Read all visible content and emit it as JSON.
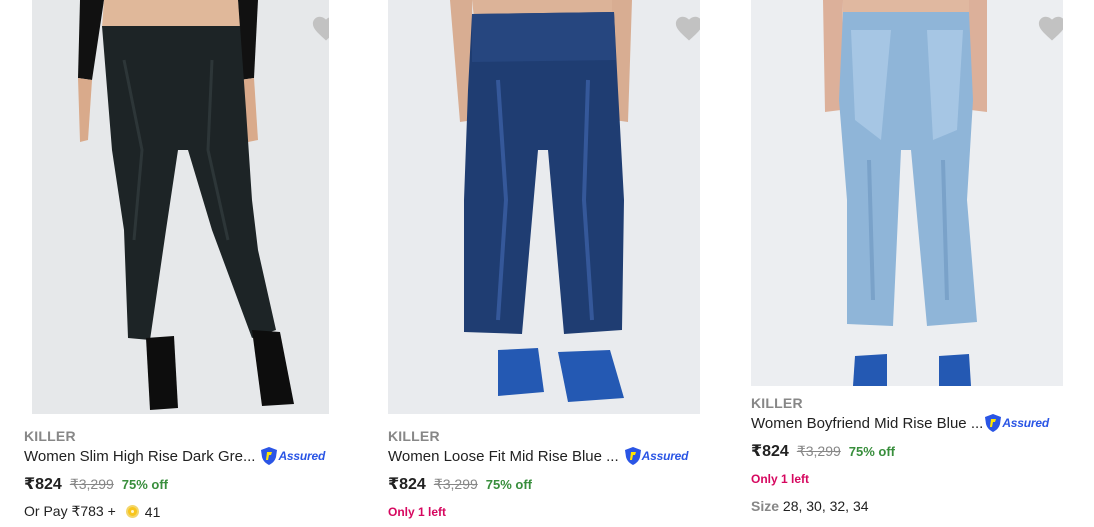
{
  "colors": {
    "heart": "#c2c2c2",
    "discount": "#388e3c",
    "low_stock": "#d6075f",
    "assured": "#2a55e5",
    "brand": "#878787"
  },
  "products": [
    {
      "brand": "KILLER",
      "title": "Women Slim High Rise Dark Gre...",
      "assured": "Assured",
      "price": "₹824",
      "mrp": "₹3,299",
      "discount": "75% off",
      "or_pay": "Or Pay ₹783 +",
      "coins": "41",
      "image": "dark-grey-slim-jeans",
      "wishlist_icon": "heart-icon"
    },
    {
      "brand": "KILLER",
      "title": "Women Loose Fit Mid Rise Blue ...",
      "assured": "Assured",
      "price": "₹824",
      "mrp": "₹3,299",
      "discount": "75% off",
      "stock": "Only 1 left",
      "image": "dark-blue-wide-leg-jeans",
      "wishlist_icon": "heart-icon"
    },
    {
      "brand": "KILLER",
      "title": "Women Boyfriend Mid Rise Blue ...",
      "assured": "Assured",
      "price": "₹824",
      "mrp": "₹3,299",
      "discount": "75% off",
      "stock": "Only 1 left",
      "size_label": "Size",
      "sizes": "28, 30, 32, 34",
      "image": "light-blue-boyfriend-jeans",
      "wishlist_icon": "heart-icon"
    }
  ]
}
